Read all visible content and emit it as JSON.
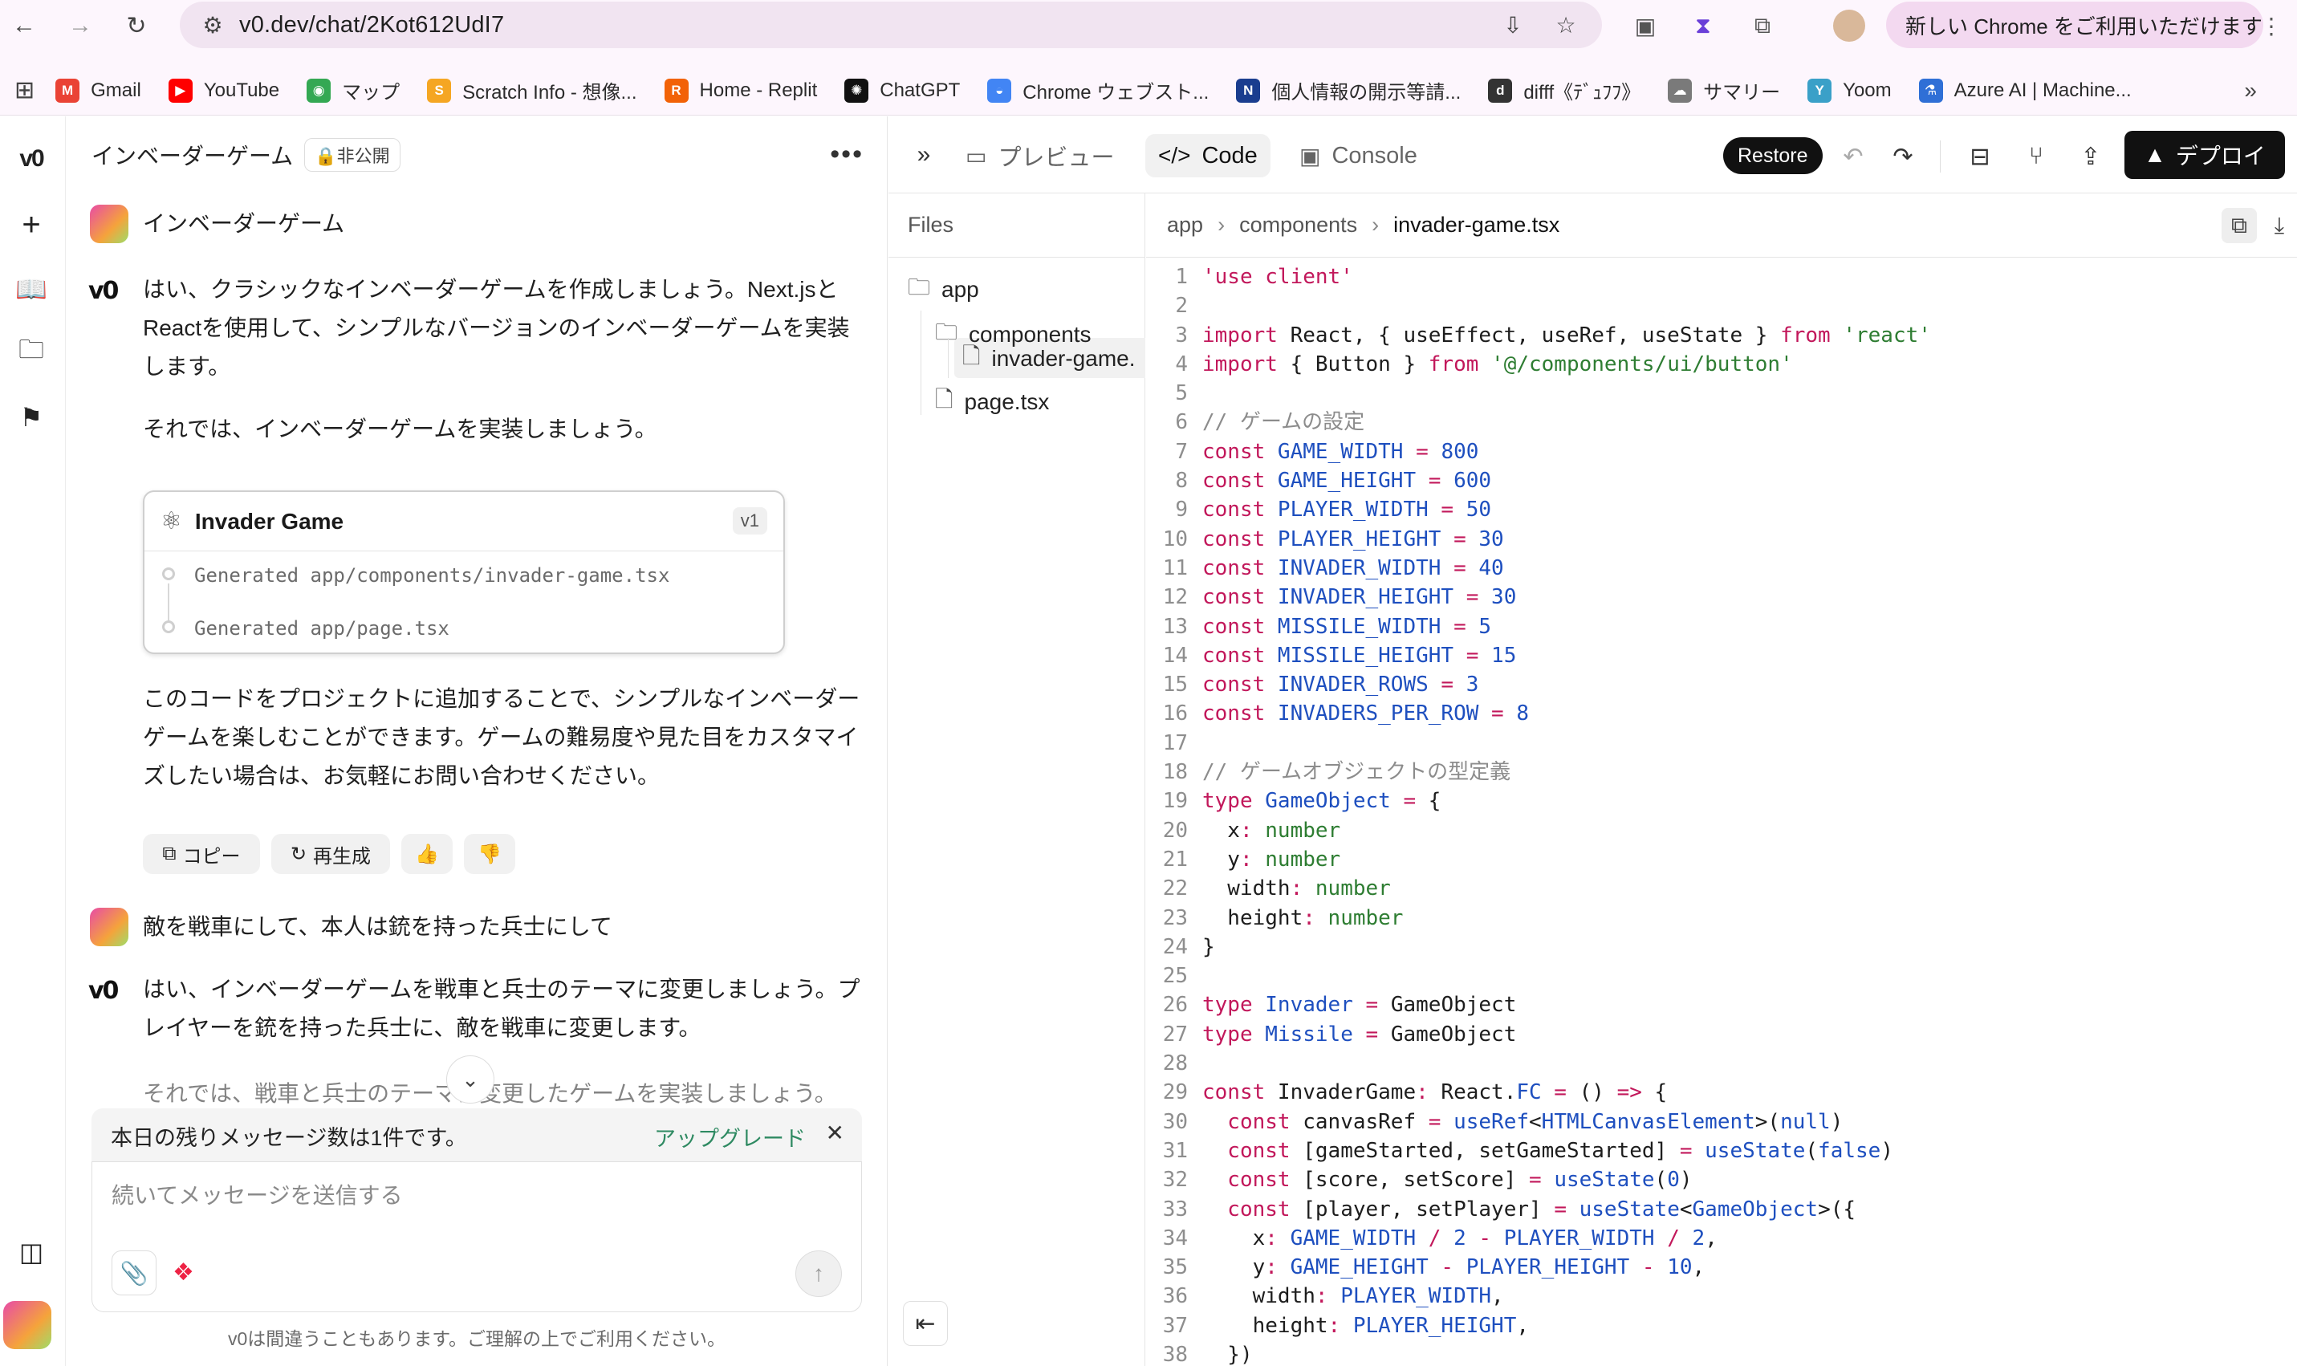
{
  "browser": {
    "url": "v0.dev/chat/2Kot612UdI7",
    "update_label": "新しい Chrome をご利用いただけます",
    "bookmarks": [
      {
        "label": "Gmail",
        "icon": "gmail-icon",
        "color": "#ea4335",
        "glyph": "M"
      },
      {
        "label": "YouTube",
        "icon": "youtube-icon",
        "color": "#ff0000",
        "glyph": "▶"
      },
      {
        "label": "マップ",
        "icon": "maps-icon",
        "color": "#34a853",
        "glyph": "◉"
      },
      {
        "label": "Scratch Info - 想像...",
        "icon": "scratch-icon",
        "color": "#f5a623",
        "glyph": "S"
      },
      {
        "label": "Home - Replit",
        "icon": "replit-icon",
        "color": "#f26207",
        "glyph": "R"
      },
      {
        "label": "ChatGPT",
        "icon": "chatgpt-icon",
        "color": "#111111",
        "glyph": "✺"
      },
      {
        "label": "Chrome ウェブスト...",
        "icon": "chrome-webstore-icon",
        "color": "#4285f4",
        "glyph": "◒"
      },
      {
        "label": "個人情報の開示等請...",
        "icon": "privacy-icon",
        "color": "#1a3d8f",
        "glyph": "N"
      },
      {
        "label": "difff《ﾃﾞｭﾌﾌ》",
        "icon": "difff-icon",
        "color": "#333333",
        "glyph": "d"
      },
      {
        "label": "サマリー",
        "icon": "summary-icon",
        "color": "#7a7a7a",
        "glyph": "☁"
      },
      {
        "label": "Yoom",
        "icon": "yoom-icon",
        "color": "#3aa0c8",
        "glyph": "Y"
      },
      {
        "label": "Azure AI | Machine...",
        "icon": "azure-ml-icon",
        "color": "#2f6fd6",
        "glyph": "⚗"
      }
    ]
  },
  "chat": {
    "title": "インベーダーゲーム",
    "private_label": "非公開",
    "messages": {
      "user1": "インベーダーゲーム",
      "bot1_p1": "はい、クラシックなインベーダーゲームを作成しましょう。Next.jsとReactを使用して、シンプルなバージョンのインベーダーゲームを実装します。",
      "bot1_p2": "それでは、インベーダーゲームを実装しましょう。",
      "bot1_p3": "このコードをプロジェクトに追加することで、シンプルなインベーダーゲームを楽しむことができます。ゲームの難易度や見た目をカスタマイズしたい場合は、お気軽にお問い合わせください。",
      "user2": "敵を戦車にして、本人は銃を持った兵士にして",
      "bot2_p1": "はい、インベーダーゲームを戦車と兵士のテーマに変更しましょう。プレイヤーを銃を持った兵士に、敵を戦車に変更します。",
      "bot2_p2_partial": "それでは、戦車と兵士のテーマに変更したゲームを実装しましょう。"
    },
    "card": {
      "title": "Invader Game",
      "version": "v1",
      "lines": [
        "Generated app/components/invader-game.tsx",
        "Generated app/page.tsx"
      ]
    },
    "actions": {
      "copy": "コピー",
      "regenerate": "再生成"
    },
    "limit_notice": "本日の残りメッセージ数は1件です。",
    "upgrade": "アップグレード",
    "composer_placeholder": "続いてメッセージを送信する",
    "disclaimer": "v0は間違うこともあります。ご理解の上でご利用ください。"
  },
  "panel": {
    "tabs": {
      "preview": "プレビュー",
      "code": "Code",
      "console": "Console"
    },
    "restore": "Restore",
    "deploy": "デプロイ",
    "files_header": "Files",
    "tree": {
      "app": "app",
      "components": "components",
      "invader": "invader-game.",
      "page": "page.tsx"
    },
    "breadcrumb": [
      "app",
      "components",
      "invader-game.tsx"
    ]
  },
  "code_lines": [
    [
      [
        "kw",
        "'use client'"
      ]
    ],
    [],
    [
      [
        "kw",
        "import"
      ],
      [
        "tx",
        " React, { useEffect, useRef, useState } "
      ],
      [
        "kw",
        "from"
      ],
      [
        "str",
        " 'react'"
      ]
    ],
    [
      [
        "kw",
        "import"
      ],
      [
        "tx",
        " { Button } "
      ],
      [
        "kw",
        "from"
      ],
      [
        "str",
        " '@/components/ui/button'"
      ]
    ],
    [],
    [
      [
        "cm",
        "// ゲームの設定"
      ]
    ],
    [
      [
        "kw",
        "const "
      ],
      [
        "cst",
        "GAME_WIDTH"
      ],
      [
        "op",
        " = "
      ],
      [
        "num",
        "800"
      ]
    ],
    [
      [
        "kw",
        "const "
      ],
      [
        "cst",
        "GAME_HEIGHT"
      ],
      [
        "op",
        " = "
      ],
      [
        "num",
        "600"
      ]
    ],
    [
      [
        "kw",
        "const "
      ],
      [
        "cst",
        "PLAYER_WIDTH"
      ],
      [
        "op",
        " = "
      ],
      [
        "num",
        "50"
      ]
    ],
    [
      [
        "kw",
        "const "
      ],
      [
        "cst",
        "PLAYER_HEIGHT"
      ],
      [
        "op",
        " = "
      ],
      [
        "num",
        "30"
      ]
    ],
    [
      [
        "kw",
        "const "
      ],
      [
        "cst",
        "INVADER_WIDTH"
      ],
      [
        "op",
        " = "
      ],
      [
        "num",
        "40"
      ]
    ],
    [
      [
        "kw",
        "const "
      ],
      [
        "cst",
        "INVADER_HEIGHT"
      ],
      [
        "op",
        " = "
      ],
      [
        "num",
        "30"
      ]
    ],
    [
      [
        "kw",
        "const "
      ],
      [
        "cst",
        "MISSILE_WIDTH"
      ],
      [
        "op",
        " = "
      ],
      [
        "num",
        "5"
      ]
    ],
    [
      [
        "kw",
        "const "
      ],
      [
        "cst",
        "MISSILE_HEIGHT"
      ],
      [
        "op",
        " = "
      ],
      [
        "num",
        "15"
      ]
    ],
    [
      [
        "kw",
        "const "
      ],
      [
        "cst",
        "INVADER_ROWS"
      ],
      [
        "op",
        " = "
      ],
      [
        "num",
        "3"
      ]
    ],
    [
      [
        "kw",
        "const "
      ],
      [
        "cst",
        "INVADERS_PER_ROW"
      ],
      [
        "op",
        " = "
      ],
      [
        "num",
        "8"
      ]
    ],
    [],
    [
      [
        "cm",
        "// ゲームオブジェクトの型定義"
      ]
    ],
    [
      [
        "kw",
        "type "
      ],
      [
        "ty",
        "GameObject"
      ],
      [
        "op",
        " = "
      ],
      [
        "tx",
        "{"
      ]
    ],
    [
      [
        "tx",
        "  x"
      ],
      [
        "op",
        ":"
      ],
      [
        "str",
        " number"
      ]
    ],
    [
      [
        "tx",
        "  y"
      ],
      [
        "op",
        ":"
      ],
      [
        "str",
        " number"
      ]
    ],
    [
      [
        "tx",
        "  width"
      ],
      [
        "op",
        ":"
      ],
      [
        "str",
        " number"
      ]
    ],
    [
      [
        "tx",
        "  height"
      ],
      [
        "op",
        ":"
      ],
      [
        "str",
        " number"
      ]
    ],
    [
      [
        "tx",
        "}"
      ]
    ],
    [],
    [
      [
        "kw",
        "type "
      ],
      [
        "ty",
        "Invader"
      ],
      [
        "op",
        " = "
      ],
      [
        "tx",
        "GameObject"
      ]
    ],
    [
      [
        "kw",
        "type "
      ],
      [
        "ty",
        "Missile"
      ],
      [
        "op",
        " = "
      ],
      [
        "tx",
        "GameObject"
      ]
    ],
    [],
    [
      [
        "kw",
        "const "
      ],
      [
        "tx",
        "InvaderGame"
      ],
      [
        "op",
        ": "
      ],
      [
        "tx",
        "React."
      ],
      [
        "ty",
        "FC"
      ],
      [
        "op",
        " = "
      ],
      [
        "tx",
        "() "
      ],
      [
        "op",
        "=>"
      ],
      [
        "tx",
        " {"
      ]
    ],
    [
      [
        "kw",
        "  const "
      ],
      [
        "tx",
        "canvasRef "
      ],
      [
        "op",
        "= "
      ],
      [
        "fn",
        "useRef"
      ],
      [
        "tx",
        "<"
      ],
      [
        "ty",
        "HTMLCanvasElement"
      ],
      [
        "tx",
        ">("
      ],
      [
        "num",
        "null"
      ],
      [
        "tx",
        ")"
      ]
    ],
    [
      [
        "kw",
        "  const "
      ],
      [
        "tx",
        "[gameStarted, setGameStarted] "
      ],
      [
        "op",
        "= "
      ],
      [
        "fn",
        "useState"
      ],
      [
        "tx",
        "("
      ],
      [
        "num",
        "false"
      ],
      [
        "tx",
        ")"
      ]
    ],
    [
      [
        "kw",
        "  const "
      ],
      [
        "tx",
        "[score, setScore] "
      ],
      [
        "op",
        "= "
      ],
      [
        "fn",
        "useState"
      ],
      [
        "tx",
        "("
      ],
      [
        "num",
        "0"
      ],
      [
        "tx",
        ")"
      ]
    ],
    [
      [
        "kw",
        "  const "
      ],
      [
        "tx",
        "[player, setPlayer] "
      ],
      [
        "op",
        "= "
      ],
      [
        "fn",
        "useState"
      ],
      [
        "tx",
        "<"
      ],
      [
        "ty",
        "GameObject"
      ],
      [
        "tx",
        ">({"
      ]
    ],
    [
      [
        "tx",
        "    x"
      ],
      [
        "op",
        ": "
      ],
      [
        "cst",
        "GAME_WIDTH"
      ],
      [
        "op",
        " / "
      ],
      [
        "num",
        "2"
      ],
      [
        "op",
        " - "
      ],
      [
        "cst",
        "PLAYER_WIDTH"
      ],
      [
        "op",
        " / "
      ],
      [
        "num",
        "2"
      ],
      [
        "tx",
        ","
      ]
    ],
    [
      [
        "tx",
        "    y"
      ],
      [
        "op",
        ": "
      ],
      [
        "cst",
        "GAME_HEIGHT"
      ],
      [
        "op",
        " - "
      ],
      [
        "cst",
        "PLAYER_HEIGHT"
      ],
      [
        "op",
        " - "
      ],
      [
        "num",
        "10"
      ],
      [
        "tx",
        ","
      ]
    ],
    [
      [
        "tx",
        "    width"
      ],
      [
        "op",
        ": "
      ],
      [
        "cst",
        "PLAYER_WIDTH"
      ],
      [
        "tx",
        ","
      ]
    ],
    [
      [
        "tx",
        "    height"
      ],
      [
        "op",
        ": "
      ],
      [
        "cst",
        "PLAYER_HEIGHT"
      ],
      [
        "tx",
        ","
      ]
    ],
    [
      [
        "tx",
        "  })"
      ]
    ]
  ]
}
